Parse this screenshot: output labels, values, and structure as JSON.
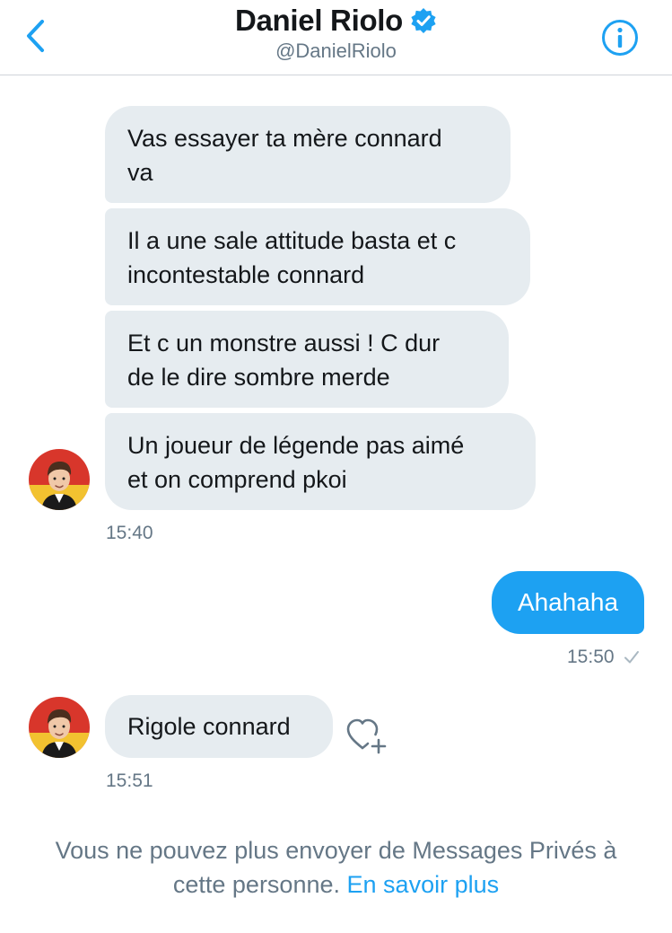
{
  "header": {
    "name": "Daniel Riolo",
    "handle": "@DanielRiolo"
  },
  "messages": [
    {
      "line1": "Vas essayer ta mère connard",
      "line2": "va"
    },
    {
      "line1": "Il a une sale attitude basta et c",
      "line2": "incontestable connard"
    },
    {
      "line1": "Et c un monstre aussi ! C dur",
      "line2": "de le dire sombre merde"
    },
    {
      "line1": "Un joueur de légende pas aimé",
      "line2": "et on comprend pkoi"
    }
  ],
  "time_received_1": "15:40",
  "sent_message": "Ahahaha",
  "time_sent": "15:50",
  "reply_message": "Rigole connard",
  "time_received_2": "15:51",
  "footer": {
    "notice_line1": "Vous ne pouvez plus envoyer de Messages Privés à",
    "notice_line2": "cette personne.",
    "link": "En savoir plus"
  },
  "colors": {
    "accent": "#1da1f2",
    "bubble_received": "#e6ecf0",
    "secondary_text": "#657786"
  },
  "icons": [
    "back-chevron-icon",
    "verified-badge-icon",
    "info-icon",
    "read-check-icon",
    "heart-plus-icon"
  ]
}
